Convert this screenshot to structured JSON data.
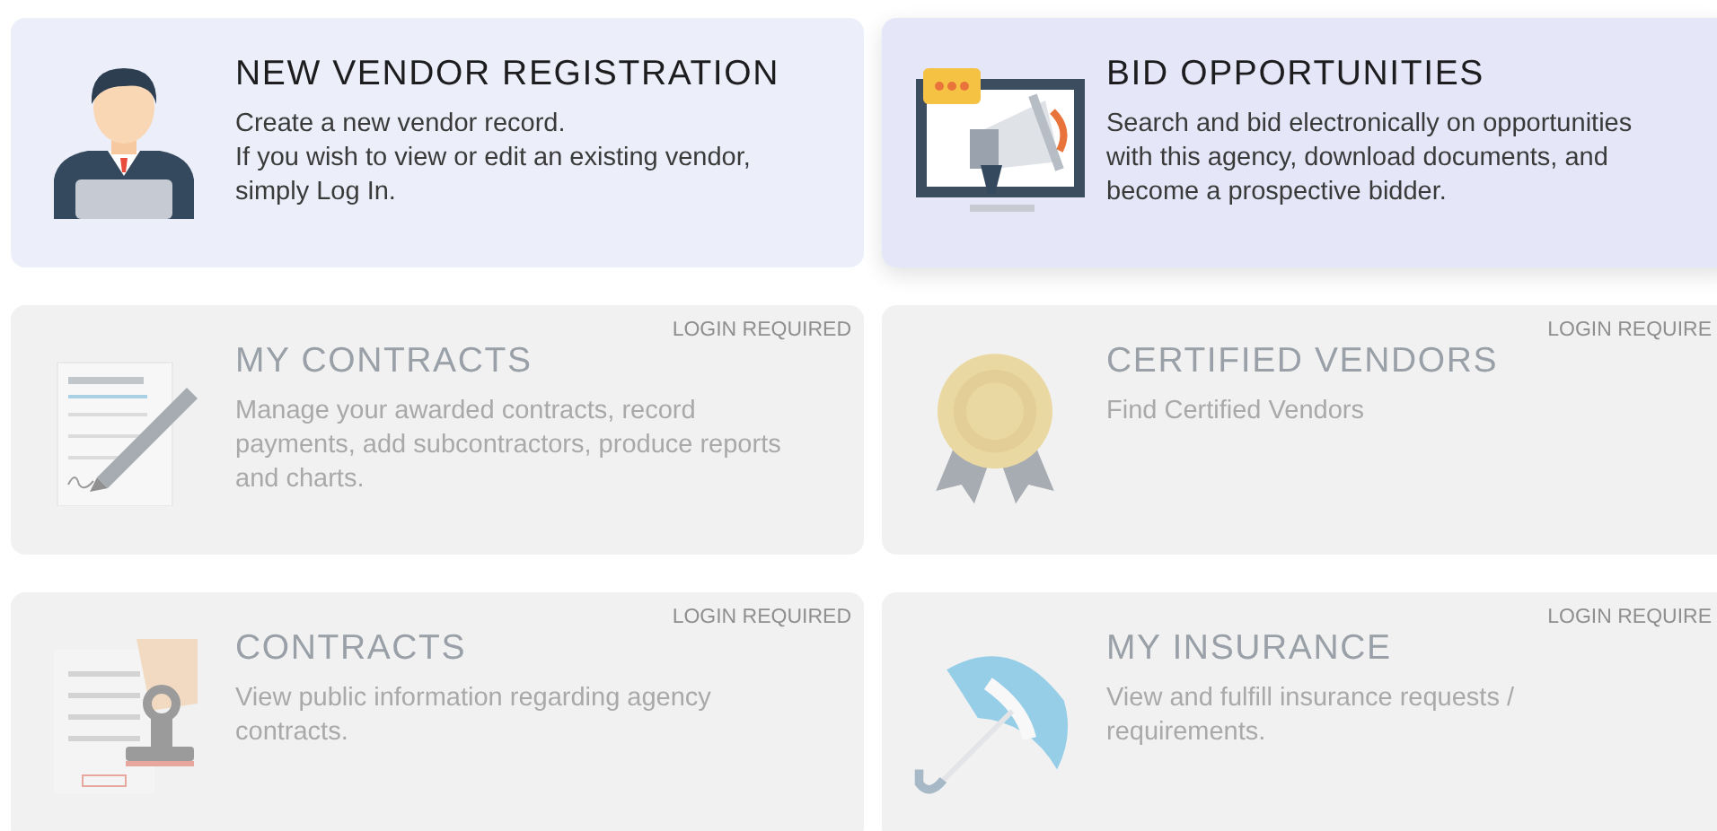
{
  "cards": [
    {
      "kind": "person",
      "title": "NEW VENDOR REGISTRATION",
      "description": [
        "Create a new vendor record.",
        "If you wish to view or edit an existing vendor, simply Log In."
      ],
      "disabled": false,
      "highlighted": false
    },
    {
      "kind": "megaphone",
      "title": "BID OPPORTUNITIES",
      "description": [
        "Search and bid electronically on opportunities with this agency, download documents, and become a prospective bidder."
      ],
      "disabled": false,
      "highlighted": true
    },
    {
      "kind": "contract",
      "title": "MY CONTRACTS",
      "badge": "LOGIN REQUIRED",
      "description": [
        "Manage your awarded contracts, record payments, add subcontractors, produce reports and charts."
      ],
      "disabled": true,
      "highlighted": false
    },
    {
      "kind": "ribbon",
      "title": "CERTIFIED VENDORS",
      "badge": "LOGIN REQUIRE",
      "description": [
        "Find Certified Vendors"
      ],
      "disabled": true,
      "highlighted": false
    },
    {
      "kind": "stamp",
      "title": "CONTRACTS",
      "badge": "LOGIN REQUIRED",
      "description": [
        "View public information regarding agency contracts."
      ],
      "disabled": true,
      "highlighted": false
    },
    {
      "kind": "umbrella",
      "title": "MY INSURANCE",
      "badge": "LOGIN REQUIRE",
      "description": [
        "View and fulfill insurance requests / requirements."
      ],
      "disabled": true,
      "highlighted": false
    }
  ]
}
